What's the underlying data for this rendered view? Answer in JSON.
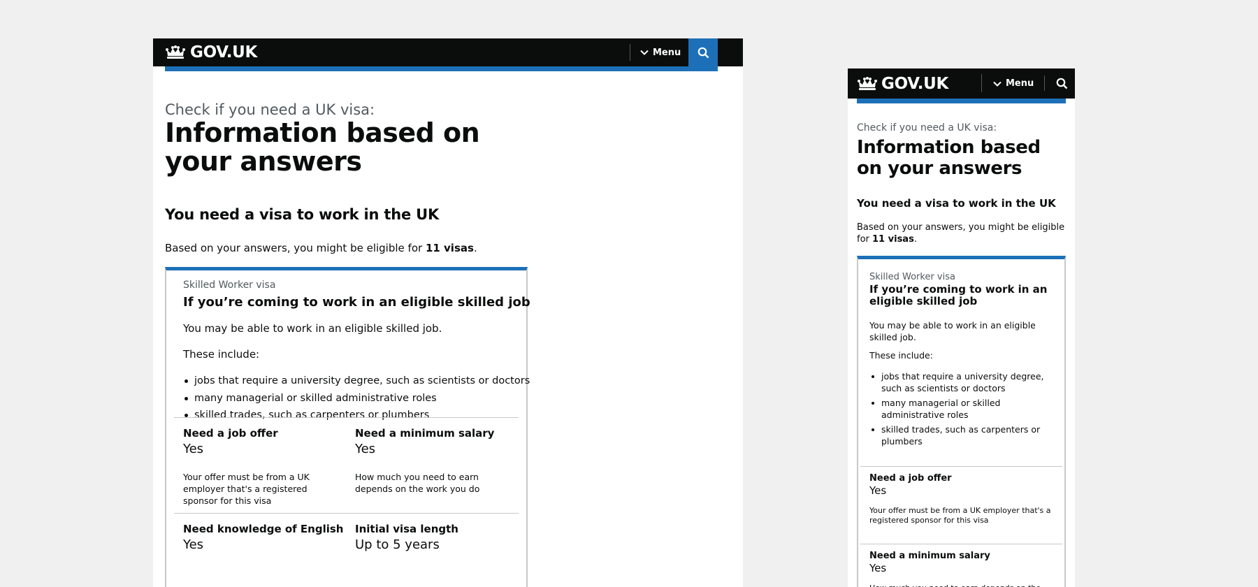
{
  "header": {
    "logo_text": "GOV.UK",
    "logo_icon": "crown-icon",
    "menu_label": "Menu",
    "menu_icon": "chevron-down-icon",
    "search_icon": "search-icon"
  },
  "colors": {
    "header_bg": "#0b0c0c",
    "accent_blue": "#1d70b8",
    "secondary_text": "#505a5f",
    "border": "#c8c8c8",
    "page_bg": "#f0f0f0"
  },
  "page": {
    "caption": "Check if you need a UK visa:",
    "title": "Information based on your answers",
    "subheading": "You need a visa to work in the UK",
    "lede_prefix": "Based on your answers, you might be eligible for ",
    "lede_bold": "11 visas",
    "lede_suffix": "."
  },
  "card": {
    "caption": "Skilled Worker visa",
    "title": "If you’re coming to work in an eligible skilled job",
    "intro": "You may be able to work in an eligible skilled job.",
    "list_intro": "These include:",
    "bullets": [
      "jobs that require a university degree, such as scientists or doctors",
      "many managerial or skilled administrative roles",
      "skilled trades, such as carpenters or plumbers"
    ],
    "facts": [
      {
        "heading": "Need a job offer",
        "value": "Yes",
        "note": "Your offer must be from a UK employer that's a registered sponsor for this visa"
      },
      {
        "heading": "Need a minimum salary",
        "value": "Yes",
        "note": "How much you need to earn depends on the work you do"
      },
      {
        "heading": "Need knowledge of English",
        "value": "Yes"
      },
      {
        "heading": "Initial visa length",
        "value": "Up to 5 years"
      }
    ]
  }
}
